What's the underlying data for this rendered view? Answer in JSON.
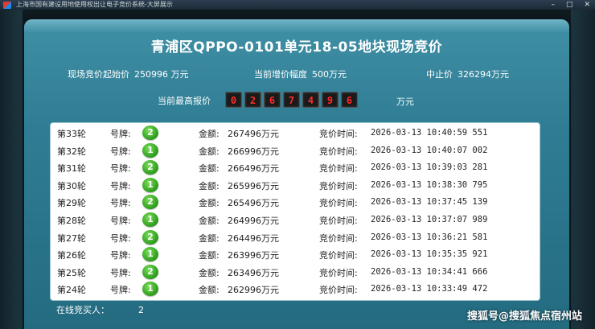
{
  "window": {
    "title": "上海市国有建设用地使用权出让电子竞价系统-大屏展示",
    "controls": [
      "–",
      "□",
      "✕"
    ]
  },
  "page_title": "青浦区QPPO-0101单元18-05地块现场竞价",
  "info": {
    "start_price_label": "现场竞价起始价",
    "start_price_value": "250996 万元",
    "increment_label": "当前增价幅度",
    "increment_value": "500万元",
    "stop_price_label": "中止价",
    "stop_price_value": "326294万元"
  },
  "highest": {
    "label": "当前最高报价",
    "digits": [
      "0",
      "2",
      "6",
      "7",
      "4",
      "9",
      "6"
    ],
    "unit": "万元"
  },
  "bids": [
    {
      "round": "第33轮",
      "plate_label": "号牌:",
      "plate": "2",
      "amount_label": "金额:",
      "amount": "267496万元",
      "time_label": "竞价时间:",
      "time": "2026-03-13 10:40:59 551"
    },
    {
      "round": "第32轮",
      "plate_label": "号牌:",
      "plate": "1",
      "amount_label": "金额:",
      "amount": "266996万元",
      "time_label": "竞价时间:",
      "time": "2026-03-13 10:40:07 002"
    },
    {
      "round": "第31轮",
      "plate_label": "号牌:",
      "plate": "2",
      "amount_label": "金额:",
      "amount": "266496万元",
      "time_label": "竞价时间:",
      "time": "2026-03-13 10:39:03 281"
    },
    {
      "round": "第30轮",
      "plate_label": "号牌:",
      "plate": "1",
      "amount_label": "金额:",
      "amount": "265996万元",
      "time_label": "竞价时间:",
      "time": "2026-03-13 10:38:30 795"
    },
    {
      "round": "第29轮",
      "plate_label": "号牌:",
      "plate": "2",
      "amount_label": "金额:",
      "amount": "265496万元",
      "time_label": "竞价时间:",
      "time": "2026-03-13 10:37:45 139"
    },
    {
      "round": "第28轮",
      "plate_label": "号牌:",
      "plate": "1",
      "amount_label": "金额:",
      "amount": "264996万元",
      "time_label": "竞价时间:",
      "time": "2026-03-13 10:37:07 989"
    },
    {
      "round": "第27轮",
      "plate_label": "号牌:",
      "plate": "2",
      "amount_label": "金额:",
      "amount": "264496万元",
      "time_label": "竞价时间:",
      "time": "2026-03-13 10:36:21 581"
    },
    {
      "round": "第26轮",
      "plate_label": "号牌:",
      "plate": "1",
      "amount_label": "金额:",
      "amount": "263996万元",
      "time_label": "竞价时间:",
      "time": "2026-03-13 10:35:35 921"
    },
    {
      "round": "第25轮",
      "plate_label": "号牌:",
      "plate": "2",
      "amount_label": "金额:",
      "amount": "263496万元",
      "time_label": "竞价时间:",
      "time": "2026-03-13 10:34:41 666"
    },
    {
      "round": "第24轮",
      "plate_label": "号牌:",
      "plate": "1",
      "amount_label": "金额:",
      "amount": "262996万元",
      "time_label": "竞价时间:",
      "time": "2026-03-13 10:33:49 472"
    }
  ],
  "online": {
    "label": "在线竞买人：",
    "count": "2"
  },
  "watermark": "搜狐号@搜狐焦点宿州站"
}
